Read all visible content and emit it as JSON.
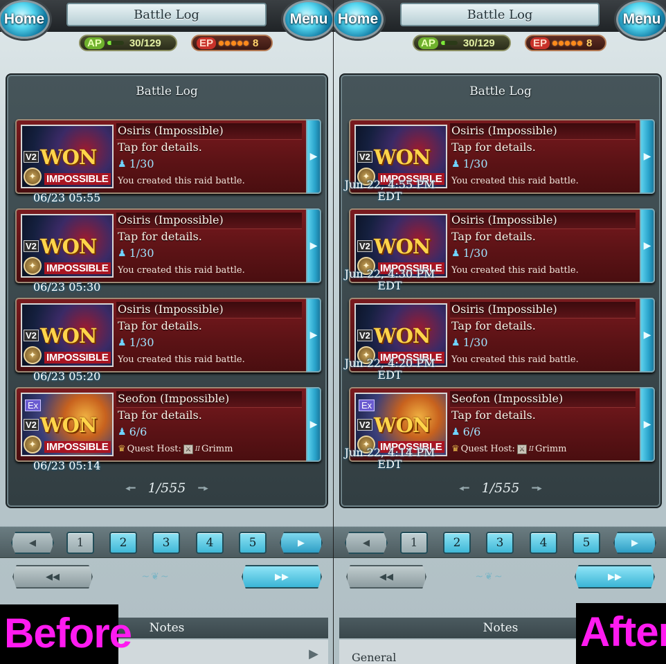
{
  "header": {
    "home_label": "Home",
    "menu_label": "Menu",
    "title": "Battle Log",
    "ap_label": "AP",
    "ap_value": "30/129",
    "ap_fraction": 0.23,
    "ep_label": "EP",
    "ep_value": "8",
    "ep_dots": 5
  },
  "log_title": "Battle Log",
  "entries_common": {
    "tap": "Tap for details.",
    "won": "WON",
    "v2": "V2",
    "ex": "Ex",
    "impossible": "IMPOSSIBLE",
    "created": "You created this raid battle.",
    "quest_host_label": "Quest Host:",
    "class_mark": "II"
  },
  "entries": [
    {
      "name": "Osiris (Impossible)",
      "players": "1/30",
      "before_time": "06/23 05:55",
      "after_time_line1": "Jun 22, 4:55 PM",
      "after_time_line2": "EDT"
    },
    {
      "name": "Osiris (Impossible)",
      "players": "1/30",
      "before_time": "06/23 05:30",
      "after_time_line1": "Jun 22, 4:30 PM",
      "after_time_line2": "EDT"
    },
    {
      "name": "Osiris (Impossible)",
      "players": "1/30",
      "before_time": "06/23 05:20",
      "after_time_line1": "Jun 22, 4:20 PM",
      "after_time_line2": "EDT"
    },
    {
      "name": "Seofon (Impossible)",
      "players": "6/6",
      "host": "Grimm",
      "before_time": "06/23 05:14",
      "after_time_line1": "Jun 22, 4:14 PM",
      "after_time_line2": "EDT"
    }
  ],
  "page_indicator": "1/555",
  "pagination": {
    "prev": "◀",
    "next": "▶",
    "pages": [
      "1",
      "2",
      "3",
      "4",
      "5"
    ],
    "first": "◀◀",
    "last": "▶▶"
  },
  "notes": {
    "title": "Notes",
    "general": "General"
  },
  "labels": {
    "before": "Before",
    "after": "After"
  },
  "colors": {
    "badge_text": "#ff1bf0",
    "entry_bg": "#5d1316",
    "accent_blue": "#3fb8d8"
  }
}
